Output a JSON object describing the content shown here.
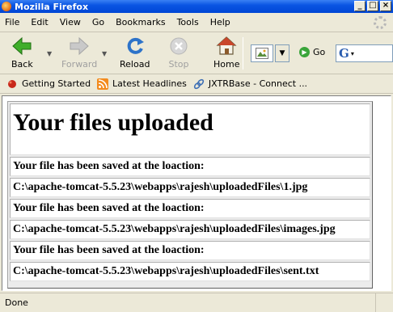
{
  "window": {
    "title": "Mozilla Firefox",
    "controls": {
      "minimize": "_",
      "maximize": "□",
      "close": "×"
    }
  },
  "menubar": {
    "items": [
      {
        "label": "File"
      },
      {
        "label": "Edit"
      },
      {
        "label": "View"
      },
      {
        "label": "Go"
      },
      {
        "label": "Bookmarks"
      },
      {
        "label": "Tools"
      },
      {
        "label": "Help"
      }
    ]
  },
  "navbar": {
    "back": {
      "label": "Back",
      "icon": "back-arrow-icon"
    },
    "forward": {
      "label": "Forward",
      "icon": "forward-arrow-icon",
      "disabled": true
    },
    "reload": {
      "label": "Reload",
      "icon": "reload-icon"
    },
    "stop": {
      "label": "Stop",
      "icon": "stop-icon",
      "disabled": true
    },
    "home": {
      "label": "Home",
      "icon": "home-icon"
    },
    "go": {
      "label": "Go"
    },
    "search_engine_glyph": "G"
  },
  "bookmarks": [
    {
      "label": "Getting Started",
      "icon": "bookmark-icon"
    },
    {
      "label": "Latest Headlines",
      "icon": "rss-icon"
    },
    {
      "label": "JXTRBase - Connect ...",
      "icon": "link-icon"
    }
  ],
  "page": {
    "heading": "Your files uploaded",
    "entries": [
      {
        "message": "Your file has been saved at the loaction:",
        "path": "C:\\apache-tomcat-5.5.23\\webapps\\rajesh\\uploadedFiles\\1.jpg"
      },
      {
        "message": "Your file has been saved at the loaction:",
        "path": "C:\\apache-tomcat-5.5.23\\webapps\\rajesh\\uploadedFiles\\images.jpg"
      },
      {
        "message": "Your file has been saved at the loaction:",
        "path": "C:\\apache-tomcat-5.5.23\\webapps\\rajesh\\uploadedFiles\\sent.txt"
      }
    ]
  },
  "status": {
    "text": "Done"
  },
  "colors": {
    "titlebar": "#0a55e3",
    "chrome": "#ece9d8"
  }
}
